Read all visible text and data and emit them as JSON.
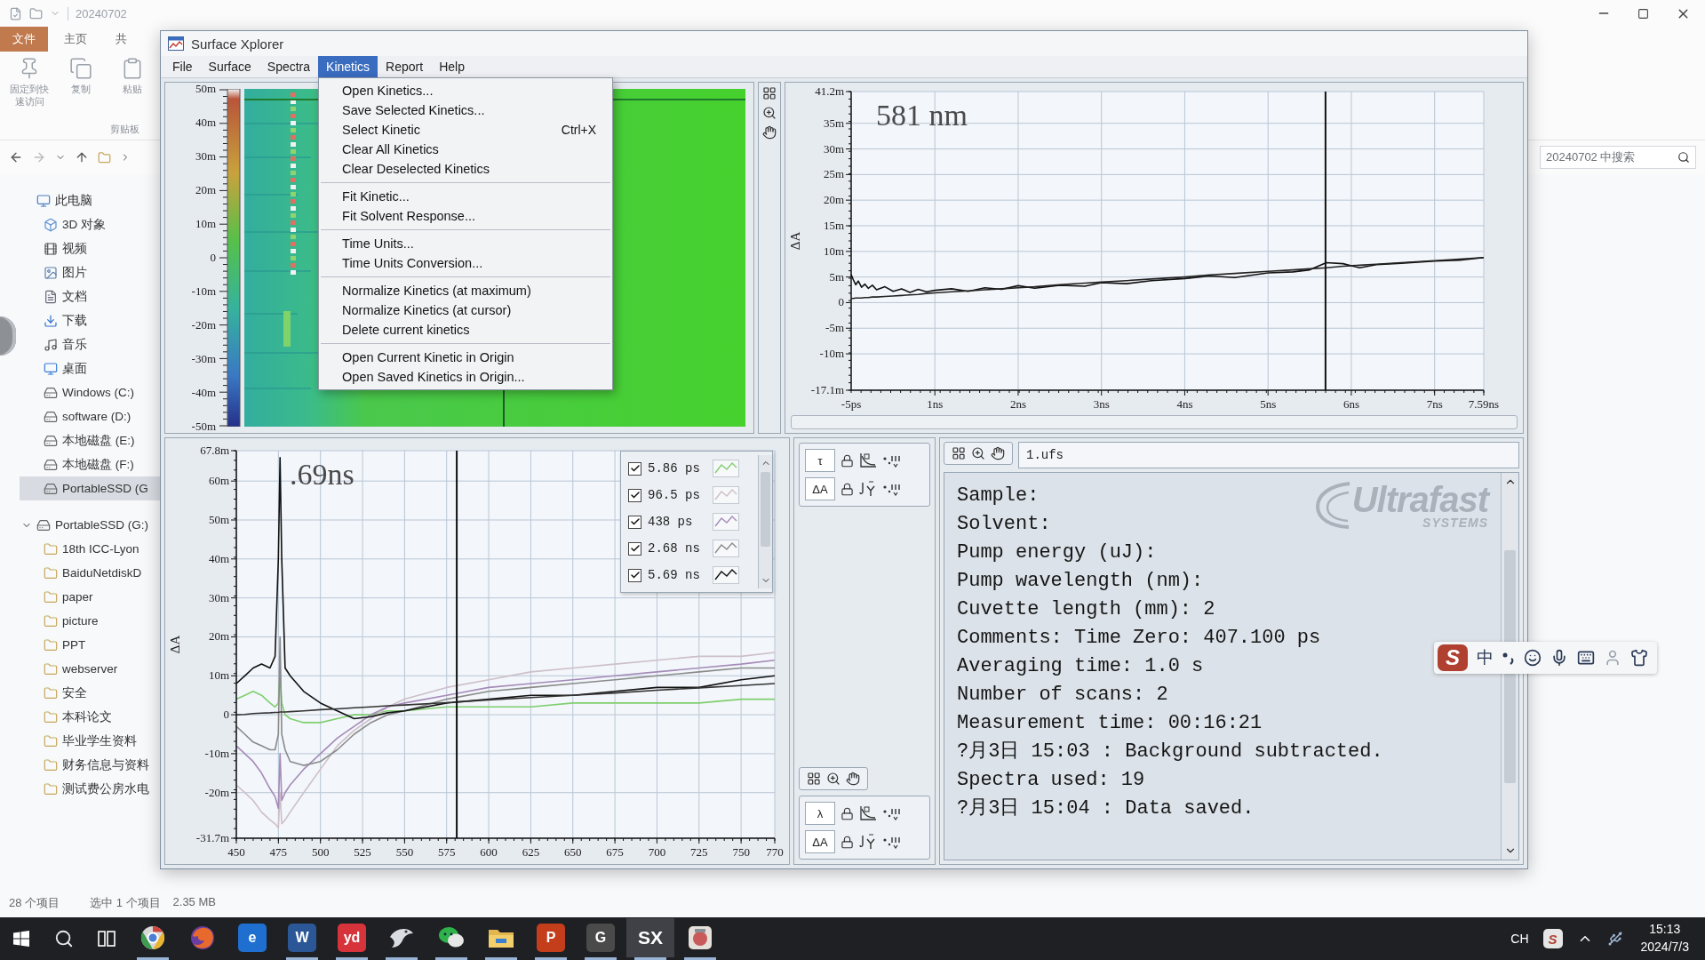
{
  "explorer": {
    "title": "20240702",
    "ribbon_tabs": [
      {
        "label": "文件",
        "kind": "menu"
      },
      {
        "label": "主页",
        "kind": "tab"
      },
      {
        "label": "共",
        "kind": "tab"
      }
    ],
    "ribbon_buttons": [
      {
        "kind": "pin",
        "label": "固定到快速访问"
      },
      {
        "kind": "copy",
        "label": "复制"
      },
      {
        "kind": "paste",
        "label": "粘贴"
      }
    ],
    "ribbon_group": "剪贴板",
    "search": {
      "placeholder": "20240702 中搜索"
    },
    "nav_tree": [
      {
        "label": "此电脑",
        "kind": "pc",
        "selected": false,
        "children": [
          {
            "label": "3D 对象",
            "kind": "cube",
            "selected": false
          },
          {
            "label": "视频",
            "kind": "video",
            "selected": false
          },
          {
            "label": "图片",
            "kind": "picture",
            "selected": false
          },
          {
            "label": "文档",
            "kind": "doc",
            "selected": false
          },
          {
            "label": "下载",
            "kind": "download",
            "selected": false
          },
          {
            "label": "音乐",
            "kind": "music",
            "selected": false
          },
          {
            "label": "桌面",
            "kind": "desktop",
            "selected": false
          },
          {
            "label": "Windows (C:)",
            "kind": "drive",
            "selected": false
          },
          {
            "label": "software (D:)",
            "kind": "drive",
            "selected": false
          },
          {
            "label": "本地磁盘 (E:)",
            "kind": "drive",
            "selected": false
          },
          {
            "label": "本地磁盘 (F:)",
            "kind": "drive",
            "selected": false
          },
          {
            "label": "PortableSSD (G",
            "kind": "drive",
            "selected": true
          }
        ]
      },
      {
        "label": "PortableSSD (G:)",
        "kind": "drive",
        "selected": false,
        "expanded": true,
        "children": [
          {
            "label": "18th ICC-Lyon",
            "kind": "folder",
            "selected": false
          },
          {
            "label": "BaiduNetdiskD",
            "kind": "folder",
            "selected": false
          },
          {
            "label": "paper",
            "kind": "folder",
            "selected": false
          },
          {
            "label": "picture",
            "kind": "folder",
            "selected": false
          },
          {
            "label": "PPT",
            "kind": "folder",
            "selected": false
          },
          {
            "label": "webserver",
            "kind": "folder",
            "selected": false
          },
          {
            "label": "安全",
            "kind": "folder",
            "selected": false
          },
          {
            "label": "本科论文",
            "kind": "folder",
            "selected": false
          },
          {
            "label": "毕业学生资料",
            "kind": "folder",
            "selected": false
          },
          {
            "label": "财务信息与资料",
            "kind": "folder",
            "selected": false
          },
          {
            "label": "测试费公房水电",
            "kind": "folder",
            "selected": false
          }
        ]
      }
    ],
    "status_bar": {
      "item_count": "28 个项目",
      "selection": "选中 1 个项目",
      "size": "2.35 MB"
    }
  },
  "surface_xplorer": {
    "title": "Surface Xplorer",
    "menu": [
      {
        "label": "File",
        "selected": false
      },
      {
        "label": "Surface",
        "selected": false
      },
      {
        "label": "Spectra",
        "selected": false
      },
      {
        "label": "Kinetics",
        "selected": true
      },
      {
        "label": "Report",
        "selected": false
      },
      {
        "label": "Help",
        "selected": false
      }
    ],
    "open_menu": {
      "groups": [
        [
          {
            "label": "Open Kinetics..."
          },
          {
            "label": "Save Selected Kinetics..."
          },
          {
            "label": "Select Kinetic",
            "shortcut": "Ctrl+X"
          },
          {
            "label": "Clear All Kinetics"
          },
          {
            "label": "Clear Deselected Kinetics"
          }
        ],
        [
          {
            "label": "Fit Kinetic..."
          },
          {
            "label": "Fit Solvent Response..."
          }
        ],
        [
          {
            "label": "Time Units..."
          },
          {
            "label": "Time Units Conversion..."
          }
        ],
        [
          {
            "label": "Normalize Kinetics (at maximum)"
          },
          {
            "label": "Normalize Kinetics (at cursor)"
          },
          {
            "label": "Delete current kinetics"
          }
        ],
        [
          {
            "label": "Open Current Kinetic in Origin"
          },
          {
            "label": "Open Saved Kinetics in Origin..."
          }
        ]
      ]
    },
    "surface": {
      "scale_ticks": [
        "50m",
        "40m",
        "30m",
        "20m",
        "10m",
        "0",
        "-10m",
        "-20m",
        "-30m",
        "-40m",
        "-50m"
      ]
    },
    "kinetic_chart": {
      "label": "581 nm",
      "axis_start_label": "-5ps",
      "chart_data": {
        "type": "line",
        "ylabel": "ΔA",
        "grid": true,
        "xlim": [
          -0.005,
          7.59
        ],
        "ylim": [
          -17.1,
          41.2
        ],
        "xticks": [
          {
            "value": 1,
            "label": "1ns"
          },
          {
            "value": 2,
            "label": "2ns"
          },
          {
            "value": 3,
            "label": "3ns"
          },
          {
            "value": 4,
            "label": "4ns"
          },
          {
            "value": 5,
            "label": "5ns"
          },
          {
            "value": 6,
            "label": "6ns"
          },
          {
            "value": 7,
            "label": "7ns"
          },
          {
            "value": 7.59,
            "label": "7.59ns"
          }
        ],
        "yticks": [
          {
            "value": 41.2,
            "label": "41.2m"
          },
          {
            "value": 35,
            "label": "35m"
          },
          {
            "value": 30,
            "label": "30m"
          },
          {
            "value": 25,
            "label": "25m"
          },
          {
            "value": 20,
            "label": "20m"
          },
          {
            "value": 15,
            "label": "15m"
          },
          {
            "value": 10,
            "label": "10m"
          },
          {
            "value": 5,
            "label": "5m"
          },
          {
            "value": 0,
            "label": "0"
          },
          {
            "value": -5,
            "label": "-5m"
          },
          {
            "value": -10,
            "label": "-10m"
          },
          {
            "value": -17.1,
            "label": "-17.1m"
          }
        ],
        "x": [
          -0.005,
          0.02,
          0.05,
          0.08,
          0.12,
          0.16,
          0.2,
          0.25,
          0.3,
          0.4,
          0.5,
          0.6,
          0.7,
          0.8,
          0.9,
          1.0,
          1.2,
          1.4,
          1.6,
          1.8,
          2.0,
          2.2,
          2.5,
          2.8,
          3.0,
          3.3,
          3.6,
          4.0,
          4.3,
          4.6,
          5.0,
          5.3,
          5.5,
          5.7,
          5.9,
          6.1,
          6.3,
          6.6,
          7.0,
          7.3,
          7.59
        ],
        "series": [
          {
            "color": "#111111",
            "values": [
              5.5,
              4.5,
              3.5,
              4.2,
              3.0,
              3.6,
              2.8,
              3.4,
              2.5,
              3.1,
              2.2,
              2.7,
              2.0,
              2.6,
              2.1,
              2.4,
              2.7,
              2.2,
              2.9,
              2.6,
              3.3,
              2.8,
              3.4,
              3.2,
              3.9,
              3.7,
              4.3,
              4.7,
              5.2,
              4.9,
              5.8,
              6.0,
              6.4,
              7.8,
              7.6,
              6.8,
              7.4,
              7.7,
              8.1,
              8.3,
              8.8
            ]
          },
          {
            "color": "#222222",
            "values": [
              0.8,
              0.8,
              0.9,
              0.9,
              0.9,
              1.0,
              1.0,
              1.1,
              1.1,
              1.2,
              1.3,
              1.4,
              1.5,
              1.6,
              1.8,
              1.9,
              2.1,
              2.3,
              2.5,
              2.7,
              2.9,
              3.1,
              3.5,
              3.8,
              4.0,
              4.3,
              4.6,
              5.0,
              5.4,
              5.7,
              6.1,
              6.4,
              6.6,
              6.8,
              7.1,
              7.3,
              7.5,
              7.8,
              8.2,
              8.5,
              8.8
            ]
          }
        ],
        "ref_lines": [
          {
            "axis": "x",
            "value": 5.69,
            "color": "#111111"
          }
        ]
      }
    },
    "spectra_chart": {
      "label": ".69ns",
      "legend": [
        {
          "checked": true
        },
        {
          "checked": true
        },
        {
          "checked": true
        },
        {
          "checked": true
        },
        {
          "checked": true
        }
      ],
      "chart_data": {
        "type": "line",
        "ylabel": "ΔA",
        "grid": true,
        "xlim": [
          450,
          770
        ],
        "ylim": [
          -31.7,
          67.8
        ],
        "xticks": [
          450,
          475,
          500,
          525,
          550,
          575,
          600,
          625,
          650,
          675,
          700,
          725,
          750,
          770
        ],
        "yticks": [
          {
            "value": 67.8,
            "label": "67.8m"
          },
          {
            "value": 60,
            "label": "60m"
          },
          {
            "value": 50,
            "label": "50m"
          },
          {
            "value": 40,
            "label": "40m"
          },
          {
            "value": 30,
            "label": "30m"
          },
          {
            "value": 20,
            "label": "20m"
          },
          {
            "value": 10,
            "label": "10m"
          },
          {
            "value": 0,
            "label": "0"
          },
          {
            "value": -10,
            "label": "-10m"
          },
          {
            "value": -20,
            "label": "-20m"
          },
          {
            "value": -31.7,
            "label": "-31.7m"
          }
        ],
        "x": [
          450,
          455,
          460,
          465,
          470,
          473,
          475,
          476,
          477,
          479,
          482,
          490,
          500,
          510,
          520,
          530,
          540,
          550,
          575,
          600,
          625,
          650,
          675,
          700,
          725,
          750,
          770
        ],
        "series": [
          {
            "name": "5.86 ps",
            "color": "#7fcf6f",
            "values": [
              4,
              5,
              6,
              5,
              3,
              2,
              3,
              10,
              3,
              0,
              -1,
              -2,
              -2,
              -1,
              0,
              0,
              1,
              1,
              2,
              2,
              2,
              3,
              3,
              3,
              3,
              4,
              4
            ]
          },
          {
            "name": "96.5 ps",
            "color": "#cdbfc9",
            "values": [
              -18,
              -20,
              -22,
              -25,
              -27,
              -28,
              -29,
              -20,
              -28,
              -27,
              -25,
              -20,
              -14,
              -8,
              -4,
              -1,
              2,
              4,
              7,
              9,
              11,
              12,
              13,
              14,
              15,
              15,
              16
            ]
          },
          {
            "name": "438 ps",
            "color": "#a48bb8",
            "values": [
              -8,
              -10,
              -12,
              -15,
              -19,
              -21,
              -24,
              -10,
              -22,
              -20,
              -18,
              -14,
              -10,
              -6,
              -3,
              0,
              2,
              3,
              5,
              7,
              8,
              9,
              10,
              11,
              12,
              13,
              14
            ]
          },
          {
            "name": "2.68 ns",
            "color": "#8a8a8a",
            "values": [
              -3,
              -5,
              -7,
              -8,
              -9,
              -9,
              -5,
              20,
              -5,
              -9,
              -12,
              -13,
              -12,
              -9,
              -5,
              -2,
              0,
              1,
              4,
              6,
              7,
              8,
              9,
              10,
              11,
              12,
              12
            ]
          },
          {
            "name": "5.69 ns",
            "color": "#111111",
            "values": [
              8,
              10,
              12,
              13,
              12,
              15,
              40,
              66,
              40,
              12,
              10,
              6,
              3,
              1,
              -1,
              -0.5,
              0.5,
              1,
              3,
              4,
              5,
              5,
              6,
              7,
              7,
              9,
              10
            ]
          },
          {
            "color": "#333333",
            "values": [
              0,
              0.1,
              0.3,
              0.4,
              0.5,
              0.6,
              0.6,
              0.7,
              0.7,
              0.7,
              0.8,
              1,
              1.3,
              1.5,
              1.8,
              2,
              2.3,
              2.5,
              3.1,
              3.8,
              4.4,
              5,
              5.6,
              6.3,
              6.9,
              7.5,
              8
            ]
          }
        ],
        "ref_lines": [
          {
            "axis": "x",
            "value": 581,
            "color": "#111111"
          }
        ]
      }
    },
    "kinetic_axes": [
      "τ",
      "ΔA"
    ],
    "spectra_axes": [
      "λ",
      "ΔA"
    ],
    "file_name": "1.ufs",
    "info_lines": [
      "Sample:",
      "Solvent:",
      "Pump energy (uJ):",
      "Pump wavelength (nm):",
      "Cuvette length (mm): 2",
      "Comments: Time Zero: 407.100 ps",
      "Averaging time: 1.0 s",
      "Number of scans: 2",
      "Measurement time: 00:16:21",
      "?月3日 15:03 : Background subtracted.",
      "Spectra used: 19",
      "?月3日 15:04 : Data saved."
    ],
    "logo": {
      "name": "Ultrafast",
      "tagline": "SYSTEMS"
    }
  },
  "ime_bar": {
    "logo": "S",
    "mode": "中"
  },
  "taskbar": {
    "apps": [
      {
        "kind": "round",
        "selected": false,
        "running": true
      },
      {
        "kind": "fox",
        "selected": false,
        "running": false
      },
      {
        "kind": "tile",
        "label": "e",
        "color": "#1f6fd1",
        "selected": false,
        "running": false
      },
      {
        "kind": "tile",
        "label": "W",
        "color": "#2b5797",
        "selected": false,
        "running": true
      },
      {
        "kind": "tile",
        "label": "yd",
        "color": "#d6333a",
        "selected": false,
        "running": true
      },
      {
        "kind": "bird",
        "selected": false,
        "running": true
      },
      {
        "kind": "chat",
        "selected": false,
        "running": true
      },
      {
        "kind": "folder",
        "selected": false,
        "running": true
      },
      {
        "kind": "tile",
        "label": "P",
        "color": "#c43e1c",
        "selected": false,
        "running": true
      },
      {
        "kind": "tile",
        "label": "G",
        "color": "#4a4a4a",
        "selected": false,
        "running": true
      },
      {
        "kind": "text",
        "label": "SX",
        "selected": true,
        "running": true
      },
      {
        "kind": "app",
        "selected": false,
        "running": true
      }
    ],
    "tray": {
      "language": "CH",
      "ime_logo": "S",
      "time": "15:13",
      "date": "2024/7/3"
    }
  }
}
